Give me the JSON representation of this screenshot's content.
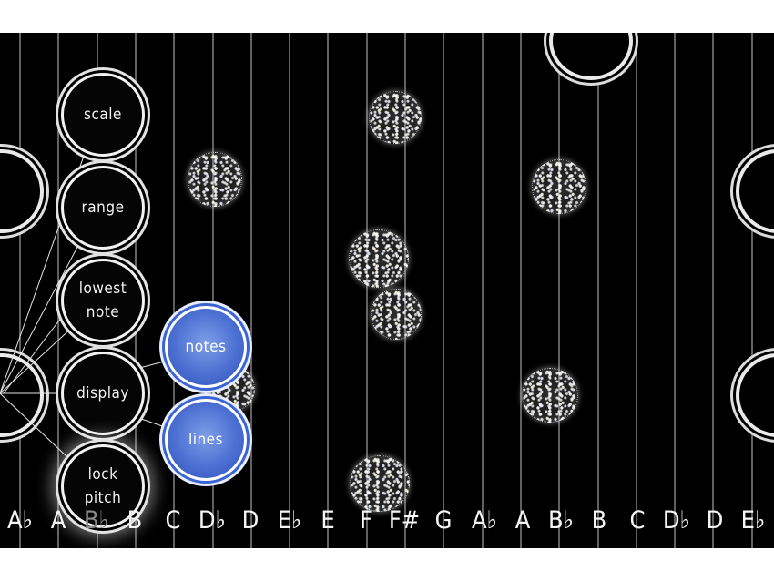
{
  "menu": {
    "scale": "scale",
    "range": "range",
    "lowest_note": [
      "lowest",
      "note"
    ],
    "display": "display",
    "lock_pitch": [
      "lock",
      "pitch"
    ]
  },
  "display_submenu": {
    "notes": "notes",
    "lines": "lines"
  },
  "note_labels": [
    "A♭",
    "A",
    "B♭",
    "B",
    "C",
    "D♭",
    "D",
    "E♭",
    "E",
    "F",
    "F#",
    "G",
    "A♭",
    "A",
    "B♭",
    "B",
    "C",
    "D♭",
    "D",
    "E♭"
  ],
  "colors": {
    "background": "#000000",
    "submenu_accent": "#4c70d2",
    "string": "#d8d8d8"
  }
}
